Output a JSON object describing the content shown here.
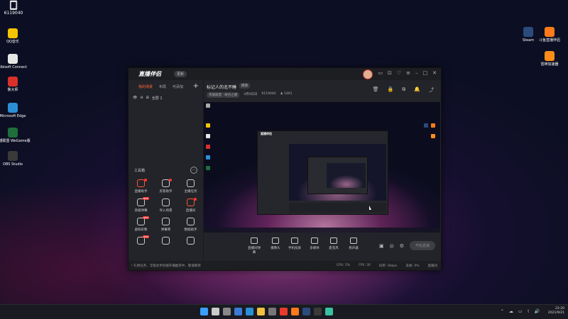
{
  "desktop": {
    "stream_number": "6119040",
    "icons_left": [
      {
        "label": "QQ音乐",
        "color": "#f5c400"
      },
      {
        "label": "Ubisoft Connect",
        "color": "#e6e6e6"
      },
      {
        "label": "鲁大师",
        "color": "#d9302c"
      },
      {
        "label": "Microsoft Edge",
        "color": "#2b8fd6"
      },
      {
        "label": "英雄联盟 WeGame版",
        "color": "#1f6e3c"
      },
      {
        "label": "OBS Studio",
        "color": "#3a3a3a"
      }
    ],
    "icons_right": [
      {
        "label": "Steam",
        "color": "#2a4b7c"
      },
      {
        "label": "斗鱼直播伴侣",
        "color": "#ff7a1a"
      },
      {
        "label": "雷神加速器",
        "color": "#ff8c1a"
      }
    ]
  },
  "app": {
    "logo": "直播伴侣",
    "version_badge": "更新",
    "titlebar_icons": [
      "chat-icon",
      "screen-icon",
      "heart-icon",
      "menu-icon",
      "minimize-icon",
      "maximize-icon",
      "close-icon"
    ],
    "tabs": [
      "我的场景",
      "布局",
      "可添加"
    ],
    "active_tab": "我的场景",
    "scene_name": "全屏 1",
    "tools_label": "工具箱",
    "tools": [
      {
        "label": "直播助手",
        "accent": true,
        "dot": true
      },
      {
        "label": "房管助手",
        "accent": false,
        "dot": true
      },
      {
        "label": "主播任务",
        "accent": false
      },
      {
        "label": "高级弹幕",
        "accent": false,
        "badge": "NEW"
      },
      {
        "label": "导入场景",
        "accent": false
      },
      {
        "label": "直播间",
        "accent": true,
        "dot": true
      },
      {
        "label": "虚拟形象",
        "accent": false,
        "badge": "NEW"
      },
      {
        "label": "弹幕库",
        "accent": false
      },
      {
        "label": "数据助手",
        "accent": false
      },
      {
        "label": "",
        "accent": false,
        "badge": "NEW"
      },
      {
        "label": "",
        "accent": false
      },
      {
        "label": "",
        "accent": false
      }
    ],
    "stream_title": "标记人的北不睡",
    "modify_label": "修改",
    "category": "英雄联盟 · 峡谷之巅",
    "date": "4月9日日",
    "room_id": "6119040",
    "fans": "1461",
    "header_icons": [
      "gift-icon",
      "lock-icon",
      "share-screen-icon",
      "bell-icon",
      "share-icon"
    ],
    "controls": [
      "直播间弹幕",
      "摄像头",
      "手机投屏",
      "多媒体",
      "麦克风",
      "扬声器"
    ],
    "start_button": "开始直播",
    "status_tip": "礼物任务、浮窗式手机端开播推荐中，敬请期待",
    "status_tip_warning": "!",
    "status_right": [
      "CPU: 5%",
      "FPS: 30",
      "码率: 0kbps",
      "丢帧: 0%",
      "直播间"
    ]
  },
  "taskbar": {
    "apps": [
      {
        "name": "start-icon",
        "color": "#3aa0ff"
      },
      {
        "name": "search-icon",
        "color": "#cccccc"
      },
      {
        "name": "task-view-icon",
        "color": "#888888"
      },
      {
        "name": "widgets-icon",
        "color": "#3a7bd5"
      },
      {
        "name": "edge-icon",
        "color": "#2b8fd6"
      },
      {
        "name": "file-explorer-icon",
        "color": "#f0c040"
      },
      {
        "name": "store-icon",
        "color": "#777777"
      },
      {
        "name": "mi-icon",
        "color": "#e83a2a"
      },
      {
        "name": "douyu-icon",
        "color": "#ff7a1a"
      },
      {
        "name": "steam-icon",
        "color": "#2a4b7c"
      },
      {
        "name": "obs-icon",
        "color": "#3a3a3a"
      },
      {
        "name": "app-icon",
        "color": "#38c2a0"
      }
    ],
    "time": "22:20",
    "date": "2021/9/21"
  }
}
